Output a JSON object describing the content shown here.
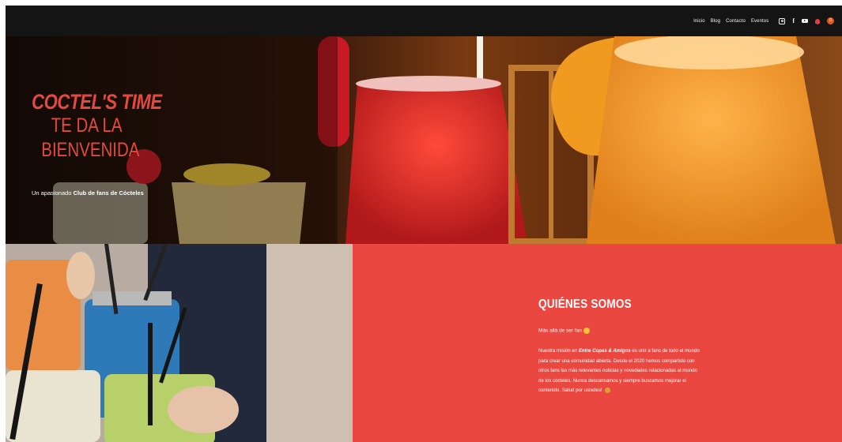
{
  "nav": {
    "items": [
      "Inicio",
      "Blog",
      "Contacto",
      "Eventos"
    ],
    "icons": [
      "instagram-icon",
      "facebook-icon",
      "youtube-icon",
      "bell-icon"
    ],
    "badge": "0",
    "facebook_glyph": "f"
  },
  "hero": {
    "title_line1": "COCTEL'S TIME",
    "title_line2": "TE DA LA",
    "title_line3": "BIENVENIDA",
    "subtitle_pre": "Un apasionado",
    "subtitle_bold": "Club de fans de Cócteles"
  },
  "about": {
    "title": "QUIÉNES SOMOS",
    "lead": "Más allá de ser fan",
    "body_pre": "Nuestra misión en",
    "body_bold": "Entre Copas & Amigos",
    "body_post": "es unir a fans de todo el mundo para crear una comunidad abierta. Desde el 2020 hemos compartido con otros fans las más relevantes noticias y novedades relacionadas al mundo de los cócteles. Nunca descansamos y siempre buscamos mejorar el contenido. Salud por ustedes!"
  },
  "colors": {
    "accent_red": "#ea4740",
    "title_red": "#e34a3d",
    "topbar": "#141414"
  }
}
